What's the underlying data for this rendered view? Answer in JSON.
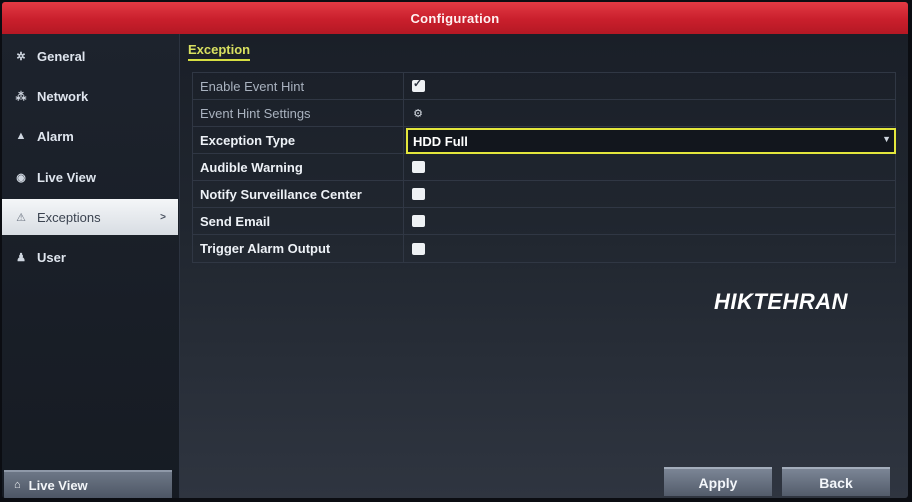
{
  "window": {
    "title": "Configuration"
  },
  "sidebar": {
    "items": [
      {
        "label": "General",
        "icon": "gear-icon",
        "active": false
      },
      {
        "label": "Network",
        "icon": "network-icon",
        "active": false
      },
      {
        "label": "Alarm",
        "icon": "alarm-icon",
        "active": false
      },
      {
        "label": "Live View",
        "icon": "eye-icon",
        "active": false
      },
      {
        "label": "Exceptions",
        "icon": "warning-icon",
        "active": true
      },
      {
        "label": "User",
        "icon": "users-icon",
        "active": false
      }
    ],
    "live_view_button": {
      "label": "Live View",
      "icon": "home-icon"
    }
  },
  "main": {
    "section_tab": "Exception",
    "rows": {
      "enable_event_hint": {
        "label": "Enable Event Hint",
        "checked": true
      },
      "event_hint_settings": {
        "label": "Event Hint Settings",
        "icon": "settings-icon"
      },
      "exception_type": {
        "label": "Exception Type",
        "value": "HDD Full"
      },
      "audible_warning": {
        "label": "Audible Warning",
        "checked": false
      },
      "notify_center": {
        "label": "Notify Surveillance Center",
        "checked": false
      },
      "send_email": {
        "label": "Send Email",
        "checked": false
      },
      "trigger_alarm": {
        "label": "Trigger Alarm Output",
        "checked": false
      }
    },
    "watermark": "HIKTEHRAN"
  },
  "footer": {
    "apply_label": "Apply",
    "back_label": "Back"
  },
  "colors": {
    "titlebar": "#c91f2c",
    "highlight": "#e3e63c",
    "background": "#1a1f28"
  }
}
